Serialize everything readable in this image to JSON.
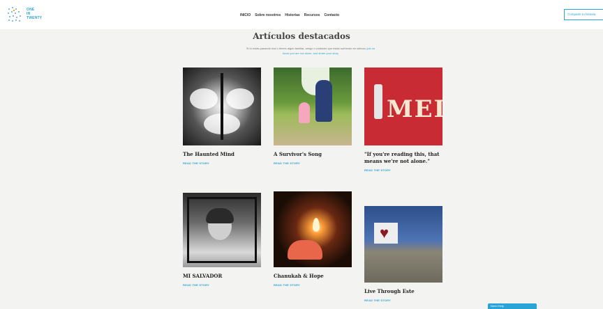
{
  "header": {
    "logo_lines": [
      "ONE",
      "IN",
      "TWENTY"
    ],
    "nav": [
      "INICIO",
      "Sobre nosotros",
      "Historias",
      "Recursos",
      "Contacto"
    ],
    "share_button": "Comparte tu historia"
  },
  "intro": {
    "title": "Artículos destacados",
    "line1": "Si tú estás pasando mal o tienes algún familiar, amigo o cuidador que están sufriendo en silencio",
    "link1": "join us",
    "line2": "know you are not alone, and share your story"
  },
  "cards": [
    {
      "title": "The Haunted Mind",
      "cta": "READ THE STORY"
    },
    {
      "title": "A Survivor's Song",
      "cta": "READ THE STORY"
    },
    {
      "title": "\"If you're reading this, that means we're not alone.\"",
      "cta": "READ THE STORY"
    },
    {
      "title": "MI SALVADOR",
      "cta": "READ THE STORY"
    },
    {
      "title": "Chanukah & Hope",
      "cta": "READ THE STORY"
    },
    {
      "title": "Live Through Este",
      "cta": "READ THE STORY"
    }
  ],
  "chat": {
    "label": "Need Help"
  }
}
